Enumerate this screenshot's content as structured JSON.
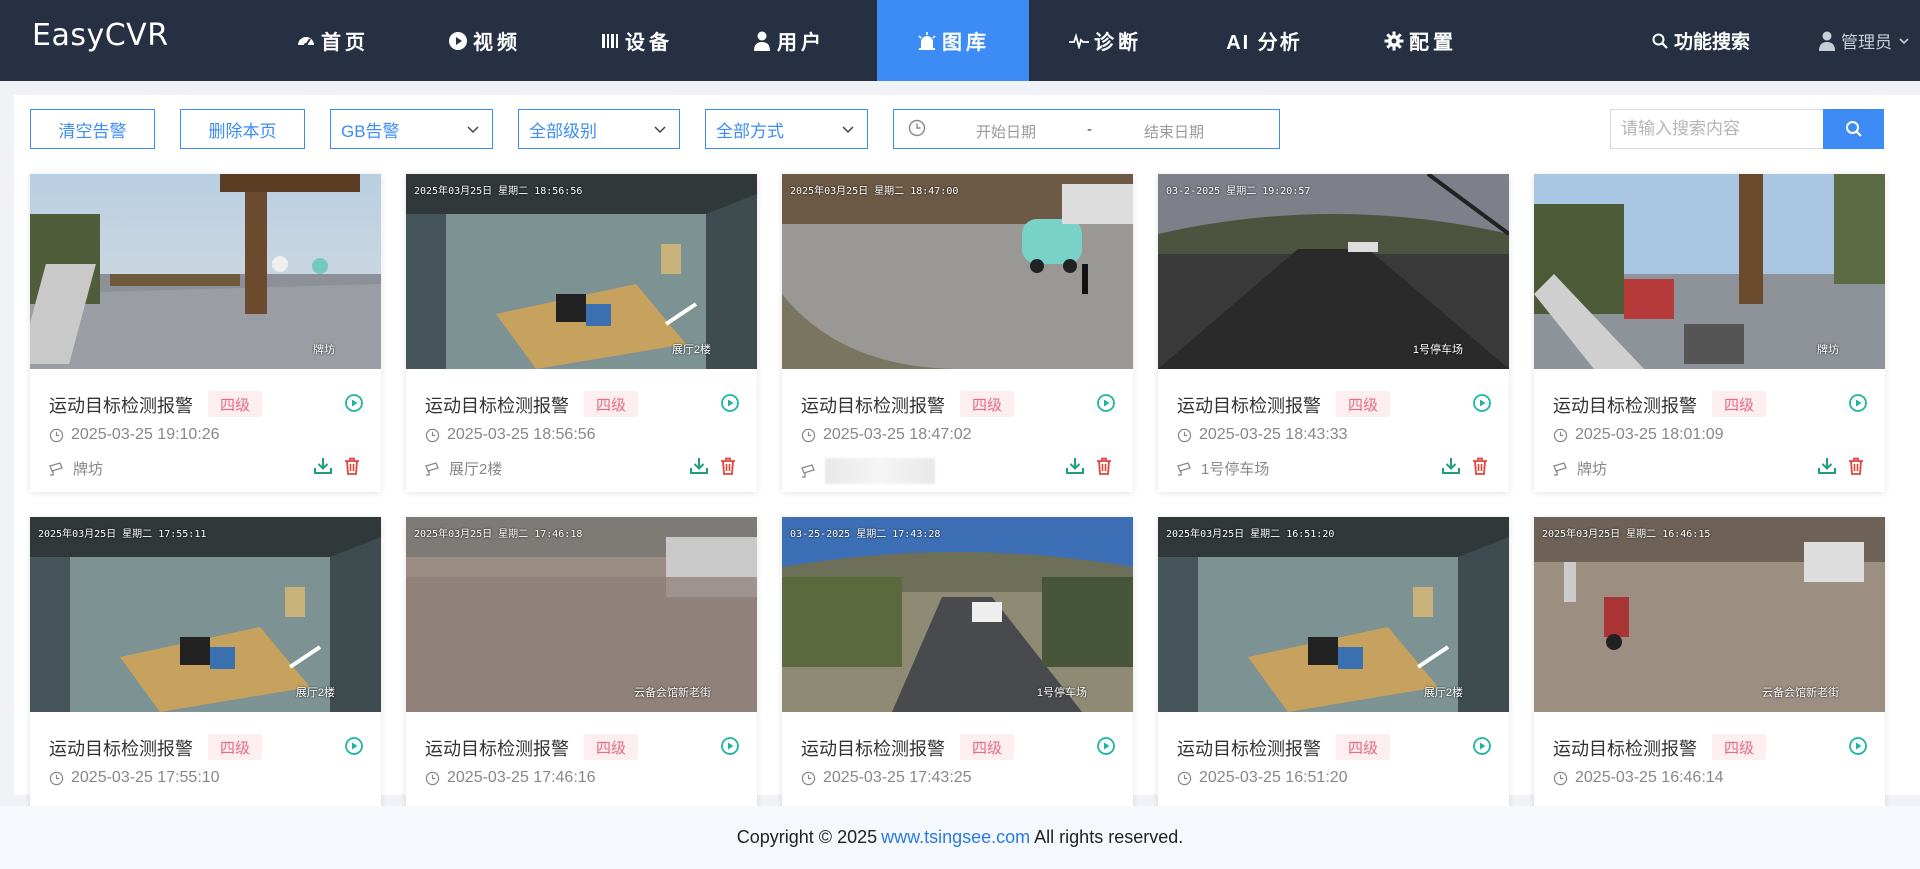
{
  "app": {
    "logo": "EasyCVR"
  },
  "nav": [
    {
      "label": "首页",
      "icon": "dashboard-icon",
      "active": false
    },
    {
      "label": "视频",
      "icon": "play-circle-icon",
      "active": false
    },
    {
      "label": "设备",
      "icon": "device-icon",
      "active": false
    },
    {
      "label": "用户",
      "icon": "user-icon",
      "active": false
    },
    {
      "label": "图库",
      "icon": "alarm-icon",
      "active": true
    },
    {
      "label": "诊断",
      "icon": "pulse-icon",
      "active": false
    },
    {
      "label": "AI 分析",
      "icon": "",
      "active": false
    },
    {
      "label": "配置",
      "icon": "gear-icon",
      "active": false
    }
  ],
  "header": {
    "search_label": "功能搜索",
    "user_label": "管理员"
  },
  "toolbar": {
    "clear_label": "清空告警",
    "delete_page_label": "删除本页",
    "alarm_type": "GB告警",
    "level": "全部级别",
    "method": "全部方式",
    "start_placeholder": "开始日期",
    "range_sep": "-",
    "end_placeholder": "结束日期",
    "search_placeholder": "请输入搜索内容"
  },
  "colors": {
    "nav_bg": "#263042",
    "accent": "#3d8cf5",
    "level_bg": "#fdeef0",
    "level_text": "#e56b84",
    "play": "#1cb4a3",
    "download": "#1e9e7a",
    "delete": "#e0463c"
  },
  "cards": [
    {
      "title": "运动目标检测报警",
      "level": "四级",
      "time": "2025-03-25 19:10:26",
      "location": "牌坊",
      "cam_label": "牌坊",
      "osd": "",
      "scene": "gate"
    },
    {
      "title": "运动目标检测报警",
      "level": "四级",
      "time": "2025-03-25 18:56:56",
      "location": "展厅2楼",
      "cam_label": "展厅2楼",
      "osd": "2025年03月25日 星期二 18:56:56",
      "scene": "office"
    },
    {
      "title": "运动目标检测报警",
      "level": "四级",
      "time": "2025-03-25 18:47:02",
      "location": "",
      "cam_label": "",
      "osd": "2025年03月25日 星期二 18:47:00",
      "scene": "yard"
    },
    {
      "title": "运动目标检测报警",
      "level": "四级",
      "time": "2025-03-25 18:43:33",
      "location": "1号停车场",
      "cam_label": "1号停车场",
      "osd": "03-2-2025 星期二 19:20:57",
      "scene": "parking-night"
    },
    {
      "title": "运动目标检测报警",
      "level": "四级",
      "time": "2025-03-25 18:01:09",
      "location": "牌坊",
      "cam_label": "牌坊",
      "osd": "",
      "scene": "gate2"
    },
    {
      "title": "运动目标检测报警",
      "level": "四级",
      "time": "2025-03-25 17:55:10",
      "location": "",
      "cam_label": "展厅2楼",
      "osd": "2025年03月25日 星期二 17:55:11",
      "scene": "office"
    },
    {
      "title": "运动目标检测报警",
      "level": "四级",
      "time": "2025-03-25 17:46:16",
      "location": "",
      "cam_label": "云备会馆新老街",
      "osd": "2025年03月25日 星期二 17:46:18",
      "scene": "hazy"
    },
    {
      "title": "运动目标检测报警",
      "level": "四级",
      "time": "2025-03-25 17:43:25",
      "location": "",
      "cam_label": "1号停车场",
      "osd": "03-25-2025 星期二 17:43:28",
      "scene": "parking-day"
    },
    {
      "title": "运动目标检测报警",
      "level": "四级",
      "time": "2025-03-25 16:51:20",
      "location": "",
      "cam_label": "展厅2楼",
      "osd": "2025年03月25日 星期二 16:51:20",
      "scene": "office"
    },
    {
      "title": "运动目标检测报警",
      "level": "四级",
      "time": "2025-03-25 16:46:14",
      "location": "",
      "cam_label": "云备会馆新老街",
      "osd": "2025年03月25日 星期二 16:46:15",
      "scene": "yard2"
    }
  ],
  "footer": {
    "prefix": "Copyright © 2025",
    "link": "www.tsingsee.com",
    "suffix": "All rights reserved."
  }
}
